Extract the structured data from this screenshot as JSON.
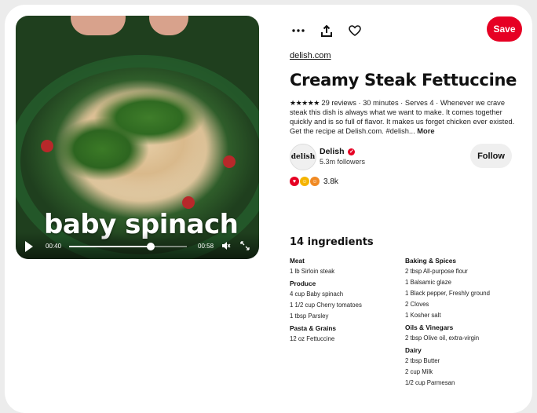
{
  "video": {
    "overlay_text": "baby spinach",
    "current_time": "00:40",
    "duration": "00:58",
    "progress": 0.69
  },
  "actions": {
    "more_icon": "ellipsis-icon",
    "share_icon": "share-icon",
    "like_icon": "heart-icon",
    "save_label": "Save"
  },
  "pin": {
    "source": "delish.com",
    "title": "Creamy Steak Fettuccine",
    "stars": "★★★★★",
    "meta": " 29 reviews · 30 minutes · Serves 4 · ",
    "description": "Whenever we crave steak this dish is always what we want to make. It comes together quickly and is so full of flavor. It makes us forget chicken ever existed. Get the recipe at Delish.com. #delish...",
    "more_label": "More"
  },
  "creator": {
    "avatar_text": "delish",
    "name": "Delish",
    "followers": "5.3m followers",
    "follow_label": "Follow"
  },
  "reactions": {
    "count": "3.8k"
  },
  "ingredients": {
    "title": "14 ingredients",
    "left": [
      {
        "category": "Meat",
        "items": [
          "1 lb Sirloin steak"
        ]
      },
      {
        "category": "Produce",
        "items": [
          "4 cup Baby spinach",
          "1 1/2 cup Cherry tomatoes",
          "1 tbsp Parsley"
        ]
      },
      {
        "category": "Pasta & Grains",
        "items": [
          "12 oz Fettuccine"
        ]
      }
    ],
    "right": [
      {
        "category": "Baking & Spices",
        "items": [
          "2 tbsp All-purpose flour",
          "1 Balsamic glaze",
          "1 Black pepper, Freshly ground",
          "2 Cloves",
          "1 Kosher salt"
        ]
      },
      {
        "category": "Oils & Vinegars",
        "items": [
          "2 tbsp Olive oil, extra-virgin"
        ]
      },
      {
        "category": "Dairy",
        "items": [
          "2 tbsp Butter",
          "2 cup Milk",
          "1/2 cup Parmesan"
        ]
      }
    ]
  },
  "colors": {
    "brand_red": "#e60023",
    "follow_bg": "#efefef"
  }
}
